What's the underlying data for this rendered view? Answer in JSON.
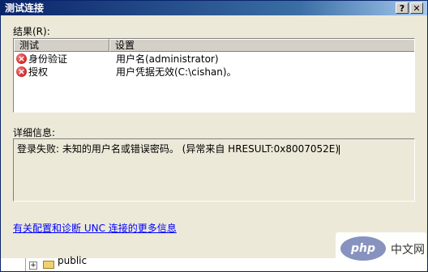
{
  "window": {
    "title": "测试连接",
    "help_glyph": "?",
    "close_glyph": "✕"
  },
  "results": {
    "label": "结果(R):",
    "columns": [
      "测试",
      "设置"
    ],
    "rows": [
      {
        "icon": "error-icon",
        "test": "身份验证",
        "setting": "用户名(administrator)"
      },
      {
        "icon": "error-icon",
        "test": "授权",
        "setting": "用户凭据无效(C:\\cishan)。"
      }
    ]
  },
  "details": {
    "label": "详细信息:",
    "text": "登录失败: 未知的用户名或错误密码。 (异常来自 HRESULT:0x8007052E)"
  },
  "link_text": "有关配置和诊断 UNC 连接的更多信息",
  "background_tree": {
    "item_label": "public"
  },
  "watermark": {
    "logo_text": "php",
    "text": "中文网"
  }
}
